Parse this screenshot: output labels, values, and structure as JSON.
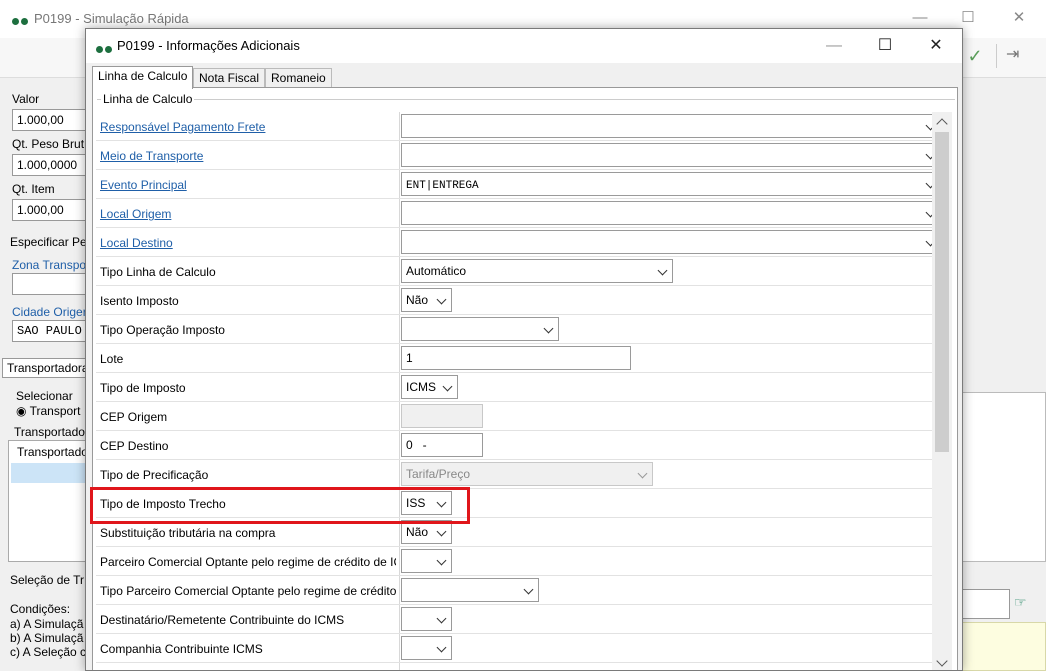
{
  "background": {
    "window_title": "P0199 - Simulação Rápida",
    "labels": {
      "valor": "Valor",
      "qt_peso_bruto": "Qt. Peso Brut",
      "qt_item": "Qt. Item",
      "especificar": "Especificar Pe",
      "zona": "Zona Transpo",
      "cidade_origem": "Cidade Origer",
      "transportadora_tab": "Transportadora",
      "selecionar": "Selecionar",
      "transport_radio": "Transport",
      "transportado_group": "Transportado",
      "transportado_col": "Transportado",
      "selecao": "Seleção de Tr",
      "condicoes": "Condições:",
      "cond_a": "a) A Simulaçã",
      "cond_b": "b) A Simulaçã",
      "cond_c": "c) A Seleção c"
    },
    "values": {
      "valor": "1.000,00",
      "qt_peso_bruto": "1.000,0000",
      "qt_item": "1.000,00",
      "cidade_origem": "SAO PAULO"
    }
  },
  "dialog": {
    "title": "P0199 - Informações Adicionais",
    "tabs": [
      "Linha de Calculo",
      "Nota Fiscal",
      "Romaneio"
    ],
    "group_label": "Linha de Calculo",
    "rows": [
      {
        "label": "Responsável Pagamento Frete",
        "value": ""
      },
      {
        "label": "Meio de Transporte",
        "value": ""
      },
      {
        "label": "Evento Principal",
        "value": "ENT|ENTREGA"
      },
      {
        "label": "Local Origem",
        "value": ""
      },
      {
        "label": "Local Destino",
        "value": ""
      },
      {
        "label": "Tipo Linha de Calculo",
        "value": "Automático"
      },
      {
        "label": "Isento Imposto",
        "value": "Não"
      },
      {
        "label": "Tipo Operação Imposto",
        "value": ""
      },
      {
        "label": "Lote",
        "value": "1"
      },
      {
        "label": "Tipo de Imposto",
        "value": "ICMS"
      },
      {
        "label": "CEP Origem",
        "value": ""
      },
      {
        "label": "CEP Destino",
        "value": "0   -"
      },
      {
        "label": "Tipo de Precificação",
        "value": "Tarifa/Preço"
      },
      {
        "label": "Tipo de Imposto Trecho",
        "value": "ISS"
      },
      {
        "label": "Substituição tributária na compra",
        "value": "Não"
      },
      {
        "label": "Parceiro Comercial Optante pelo regime de crédito de ICMS",
        "value": ""
      },
      {
        "label": "Tipo Parceiro Comercial Optante pelo regime de crédito",
        "value": ""
      },
      {
        "label": "Destinatário/Remetente Contribuinte do ICMS",
        "value": ""
      },
      {
        "label": "Companhia Contribuinte ICMS",
        "value": ""
      }
    ]
  },
  "icons": {
    "window_minimize": "—",
    "window_maximize": "☐",
    "window_close": "✕",
    "confirm": "✓",
    "exit": "⇥",
    "pointer": "☞"
  },
  "colors": {
    "link": "#1f5fa8",
    "highlight": "#e0161b",
    "brand_dot": "#1d6f3f"
  }
}
